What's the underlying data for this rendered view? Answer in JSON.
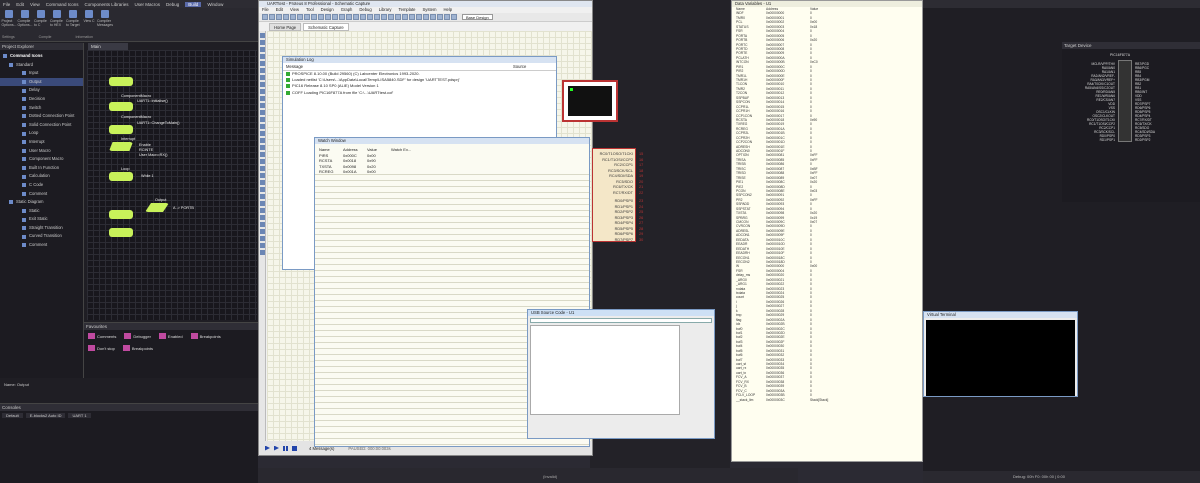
{
  "ide": {
    "menu": [
      "File",
      "Edit",
      "View",
      "Command Icons",
      "Components Libraries",
      "User Macros",
      "Debug",
      "Build",
      "Window"
    ],
    "menu_selected": "Build",
    "ribbon": [
      "Project Options...",
      "Compile Options...",
      "Compile to C",
      "Compile to HEX",
      "Compile to Target",
      "View C",
      "Compiler Messages"
    ],
    "ribbon_groups": [
      "Settings",
      "Compile",
      "Information"
    ],
    "project_explorer_title": "Project Explorer",
    "tree_header": "Command Icons",
    "tree_group1": "Standard",
    "tree_items1": [
      "Input",
      "Output",
      "Delay",
      "Decision",
      "Switch",
      "Dotted Connection Point",
      "Solid Connection Point",
      "Loop",
      "Interrupt",
      "User Macro",
      "Component Macro",
      "Built In Function",
      "Calculation",
      "C Code",
      "Comment"
    ],
    "tree_selected": "Output",
    "tree_group2": "Static Diagram",
    "tree_items2": [
      "Static",
      "Exit Static",
      "Straight Transition",
      "Curved Transition",
      "Comment"
    ],
    "flow_tab": "Main",
    "flow_labels": [
      "ComponentMacro",
      "UART1::Initialise()",
      "ComponentMacro",
      "UART1::ChangeToMain()",
      "Interrupt",
      "Enable",
      "RCINTE",
      "User Macro:RX()",
      "Loop",
      "While 1",
      "Output",
      "A -> PORTB"
    ],
    "props_title": "Favourites",
    "props_buttons": [
      "Comments",
      "Debugger",
      "Enabled",
      "Breakpoints",
      "Don't stop"
    ],
    "props_button2": "Breakpoints",
    "name_label": "Name: Output",
    "console_title": "Consoles",
    "console_tabs": [
      "Default",
      "E-blocks2 Auto ID",
      "UART 1"
    ]
  },
  "proteus": {
    "title": "UARTtest - Proteus 8 Professional - Schematic Capture",
    "menu": [
      "File",
      "Edit",
      "View",
      "Tool",
      "Design",
      "Graph",
      "Debug",
      "Library",
      "Template",
      "System",
      "Help"
    ],
    "tabs": [
      "Home Page",
      "Schematic Capture"
    ],
    "zoom": "Base Design",
    "status": "4 Message(s)",
    "paused": "PAUSED: 000:00:003s"
  },
  "simlog": {
    "title": "Simulation Log",
    "col_message": "Message",
    "col_source": "Source",
    "rows": [
      "PROSPICE 8.10.00 (Build 29560) (C) Labcenter Electronics 1993-2020.",
      "Loaded netlist 'C:\\Users\\...\\AppData\\Local\\Temp\\LISA5840.SDF' for design 'UARTTEST.pdsprj'",
      "PIC16 Release 8.10 SP0 (ALIE) Model Version 1",
      "COFF Loading PIC16F877A from file 'C:\\...\\UARTtest.cof'"
    ]
  },
  "watch": {
    "title": "Watch Window",
    "headers": [
      "Name",
      "Address",
      "Value",
      "Watch Ex..."
    ],
    "rows": [
      [
        "PIRS",
        "0x000C",
        "0x00"
      ],
      [
        "RCSTA",
        "0x0018",
        "0x90"
      ],
      [
        "TXSTA",
        "0x0098",
        "0x20"
      ],
      [
        "RCREG",
        "0x001A",
        "0x00"
      ]
    ]
  },
  "chip_pins": [
    "RC0/T1OSO/T1CKI",
    "RC1/T1OSI/CCP2",
    "RC2/CCP1",
    "RC3/SCK/SCL",
    "RC4/SDI/SDA",
    "RC5/SDO",
    "RC6/TX/CK",
    "RC7/RX/DT",
    "RD0/PSP0",
    "RD1/PSP1",
    "RD2/PSP2",
    "RD3/PSP3",
    "RD4/PSP4",
    "RD5/PSP5",
    "RD6/PSP6",
    "RD7/PSP7"
  ],
  "usb": {
    "title": "USB Source Code - U1"
  },
  "vars": {
    "title": "Data Variables - U1",
    "headers": [
      "Name",
      "Address",
      "Value"
    ],
    "rows": [
      [
        "INDF",
        "0x00000000",
        "0"
      ],
      [
        "TMR0",
        "0x00000001",
        "0"
      ],
      [
        "PCL",
        "0x00000002",
        "0x00"
      ],
      [
        "STATUS",
        "0x00000003",
        "0x18"
      ],
      [
        "FSR",
        "0x00000004",
        "0"
      ],
      [
        "PORTA",
        "0x00000005",
        "0"
      ],
      [
        "PORTB",
        "0x00000006",
        "0x20"
      ],
      [
        "PORTC",
        "0x00000007",
        "0"
      ],
      [
        "PORTD",
        "0x00000008",
        "0"
      ],
      [
        "PORTE",
        "0x00000009",
        "0"
      ],
      [
        "PCLATH",
        "0x0000000A",
        "0"
      ],
      [
        "INTCON",
        "0x0000000B",
        "0xC0"
      ],
      [
        "PIR1",
        "0x0000000C",
        "0"
      ],
      [
        "PIR2",
        "0x0000000D",
        "0"
      ],
      [
        "TMR1L",
        "0x0000000E",
        "0"
      ],
      [
        "TMR1H",
        "0x0000000F",
        "0"
      ],
      [
        "T1CON",
        "0x00000010",
        "0"
      ],
      [
        "TMR2",
        "0x00000011",
        "0"
      ],
      [
        "T2CON",
        "0x00000012",
        "0"
      ],
      [
        "SSPBUF",
        "0x00000013",
        "0"
      ],
      [
        "SSPCON",
        "0x00000014",
        "0"
      ],
      [
        "CCPR1L",
        "0x00000015",
        "0"
      ],
      [
        "CCPR1H",
        "0x00000016",
        "0"
      ],
      [
        "CCP1CON",
        "0x00000017",
        "0"
      ],
      [
        "RCSTA",
        "0x00000018",
        "0x90"
      ],
      [
        "TXREG",
        "0x00000019",
        "0"
      ],
      [
        "RCREG",
        "0x0000001A",
        "0"
      ],
      [
        "CCPR2L",
        "0x0000001B",
        "0"
      ],
      [
        "CCPR2H",
        "0x0000001C",
        "0"
      ],
      [
        "CCP2CON",
        "0x0000001D",
        "0"
      ],
      [
        "ADRESH",
        "0x0000001E",
        "0"
      ],
      [
        "ADCON0",
        "0x0000001F",
        "0"
      ],
      [
        "OPTION",
        "0x00000081",
        "0xFF"
      ],
      [
        "TRISA",
        "0x00000085",
        "0xFF"
      ],
      [
        "TRISB",
        "0x00000086",
        "0"
      ],
      [
        "TRISC",
        "0x00000087",
        "0xBF"
      ],
      [
        "TRISD",
        "0x00000088",
        "0xFF"
      ],
      [
        "TRISE",
        "0x00000089",
        "0x07"
      ],
      [
        "PIE1",
        "0x0000008C",
        "0x20"
      ],
      [
        "PIE2",
        "0x0000008D",
        "0"
      ],
      [
        "PCON",
        "0x0000008E",
        "0x03"
      ],
      [
        "SSPCON2",
        "0x00000091",
        "0"
      ],
      [
        "PR2",
        "0x00000092",
        "0xFF"
      ],
      [
        "SSPADD",
        "0x00000093",
        "0"
      ],
      [
        "SSPSTAT",
        "0x00000094",
        "0"
      ],
      [
        "TXSTA",
        "0x00000098",
        "0x20"
      ],
      [
        "SPBRG",
        "0x00000099",
        "0x19"
      ],
      [
        "CMCON",
        "0x0000009C",
        "0x07"
      ],
      [
        "CVRCON",
        "0x0000009D",
        "0"
      ],
      [
        "ADRESL",
        "0x0000009E",
        "0"
      ],
      [
        "ADCON1",
        "0x0000009F",
        "0"
      ],
      [
        "EEDATA",
        "0x0000010C",
        "0"
      ],
      [
        "EEADR",
        "0x0000010D",
        "0"
      ],
      [
        "EEDATH",
        "0x0000010E",
        "0"
      ],
      [
        "EEADRH",
        "0x0000010F",
        "0"
      ],
      [
        "EECON1",
        "0x0000018C",
        "0"
      ],
      [
        "EECON2",
        "0x0000018D",
        "0"
      ],
      [
        "W",
        "0x00000000",
        "0x00"
      ],
      [
        "FSR",
        "0x00000004",
        "0"
      ],
      [
        "delay_ms",
        "0x00000020",
        "0"
      ],
      [
        "_ARG0",
        "0x00000021",
        "0"
      ],
      [
        "_ARG1",
        "0x00000022",
        "0"
      ],
      [
        "rxdata",
        "0x00000023",
        "0"
      ],
      [
        "txdata",
        "0x00000024",
        "0"
      ],
      [
        "count",
        "0x00000025",
        "0"
      ],
      [
        "i",
        "0x00000026",
        "0"
      ],
      [
        "j",
        "0x00000027",
        "0"
      ],
      [
        "k",
        "0x00000028",
        "0"
      ],
      [
        "tmp",
        "0x00000029",
        "0"
      ],
      [
        "flag",
        "0x0000002A",
        "0"
      ],
      [
        "idx",
        "0x0000002B",
        "0"
      ],
      [
        "buf0",
        "0x0000002C",
        "0"
      ],
      [
        "buf1",
        "0x0000002D",
        "0"
      ],
      [
        "buf2",
        "0x0000002E",
        "0"
      ],
      [
        "buf3",
        "0x0000002F",
        "0"
      ],
      [
        "buf4",
        "0x00000030",
        "0"
      ],
      [
        "buf5",
        "0x00000031",
        "0"
      ],
      [
        "buf6",
        "0x00000032",
        "0"
      ],
      [
        "buf7",
        "0x00000033",
        "0"
      ],
      [
        "uart_st",
        "0x00000034",
        "0"
      ],
      [
        "uart_rx",
        "0x00000035",
        "0"
      ],
      [
        "uart_tx",
        "0x00000036",
        "0"
      ],
      [
        "FCV_A",
        "0x00000037",
        "0"
      ],
      [
        "FCV_RX",
        "0x00000038",
        "0"
      ],
      [
        "FCV_B",
        "0x00000039",
        "0"
      ],
      [
        "FCV_C",
        "0x0000003A",
        "0"
      ],
      [
        "FCLV_LOOP",
        "0x0000003B",
        "0"
      ],
      [
        "__stack_lim",
        "0x0000003C",
        "Stack[Stack]"
      ]
    ]
  },
  "vterm": {
    "title": "Virtual Terminal"
  },
  "target": {
    "title": "Target Device",
    "chip": "PIC16F877A",
    "left_pins": [
      "MCLR/VPP/THV",
      "RA0/AN0",
      "RA1/AN1",
      "RA2/AN2/VREF-",
      "RA3/AN3/VREF+",
      "RA4/T0CKI/C1OUT",
      "RA5/AN4/SS/C2OUT",
      "RE0/RD/AN5",
      "RE1/WR/AN6",
      "RE2/CS/AN7",
      "VDD",
      "VSS",
      "OSC1/CLKIN",
      "OSC2/CLKOUT",
      "RC0/T1OSO/T1CKI",
      "RC1/T1OSI/CCP2",
      "RC2/CCP1",
      "RC3/SCK/SCL",
      "RD0/PSP0",
      "RD1/PSP1"
    ],
    "right_pins": [
      "RB7/PGD",
      "RB6/PGC",
      "RB5",
      "RB4",
      "RB3/PGM",
      "RB2",
      "RB1",
      "RB0/INT",
      "VDD",
      "VSS",
      "RD7/PSP7",
      "RD6/PSP6",
      "RD5/PSP5",
      "RD4/PSP4",
      "RC7/RX/DT",
      "RC6/TX/CK",
      "RC5/SDO",
      "RC4/SDI/SDA",
      "RD3/PSP3",
      "RD2/PSP2"
    ]
  },
  "status_right": "Debug: 00h F0: 00h 00 | 0:00",
  "bottom_label": "(Invalid)"
}
